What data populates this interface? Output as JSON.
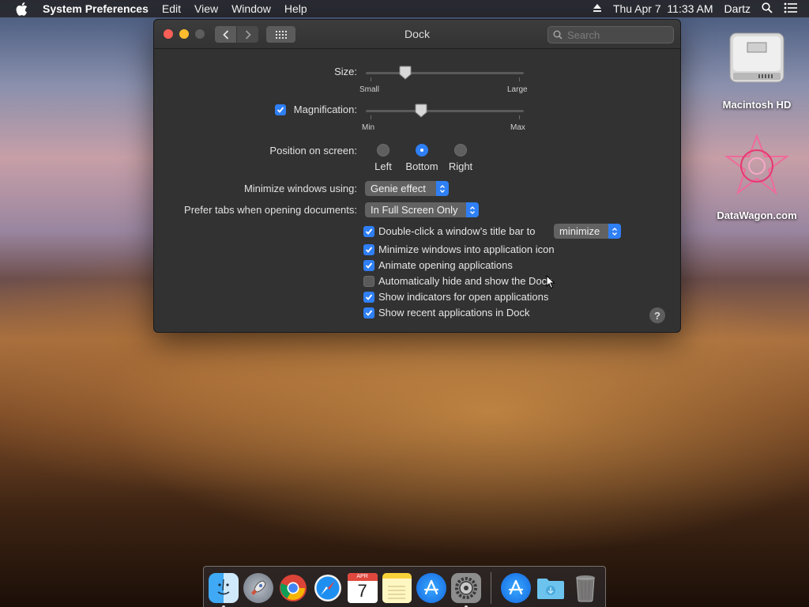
{
  "menubar": {
    "app_name": "System Preferences",
    "items": [
      "Edit",
      "View",
      "Window",
      "Help"
    ],
    "datetime": "Thu Apr 7  11:33 AM",
    "user": "Dartz"
  },
  "window": {
    "title": "Dock",
    "search_placeholder": "Search"
  },
  "size": {
    "label": "Size:",
    "min_label": "Small",
    "max_label": "Large",
    "value": 0.25
  },
  "magnification": {
    "label": "Magnification:",
    "checked": true,
    "min_label": "Min",
    "max_label": "Max",
    "value": 0.35
  },
  "position": {
    "label": "Position on screen:",
    "options": [
      "Left",
      "Bottom",
      "Right"
    ],
    "selected": "Bottom"
  },
  "minimize_using": {
    "label": "Minimize windows using:",
    "value": "Genie effect"
  },
  "prefer_tabs": {
    "label": "Prefer tabs when opening documents:",
    "value": "In Full Screen Only"
  },
  "double_click": {
    "label": "Double-click a window’s title bar to",
    "value": "minimize",
    "checked": true
  },
  "checkboxes": [
    {
      "label": "Minimize windows into application icon",
      "checked": true
    },
    {
      "label": "Animate opening applications",
      "checked": true
    },
    {
      "label": "Automatically hide and show the Dock",
      "checked": false
    },
    {
      "label": "Show indicators for open applications",
      "checked": true
    },
    {
      "label": "Show recent applications in Dock",
      "checked": true
    }
  ],
  "help": "?",
  "desktop": {
    "hd_label": "Macintosh HD",
    "site_label": "DataWagon.com"
  },
  "dock": {
    "apps": [
      "Finder",
      "Launchpad",
      "Chrome",
      "Safari",
      "Calendar",
      "Notes",
      "App Store",
      "System Preferences"
    ],
    "calendar_month": "APR",
    "calendar_day": "7",
    "recent": [
      "App Store",
      "Downloads",
      "Trash"
    ]
  },
  "colors": {
    "accent": "#2f7ff5",
    "window_bg": "#323232"
  }
}
